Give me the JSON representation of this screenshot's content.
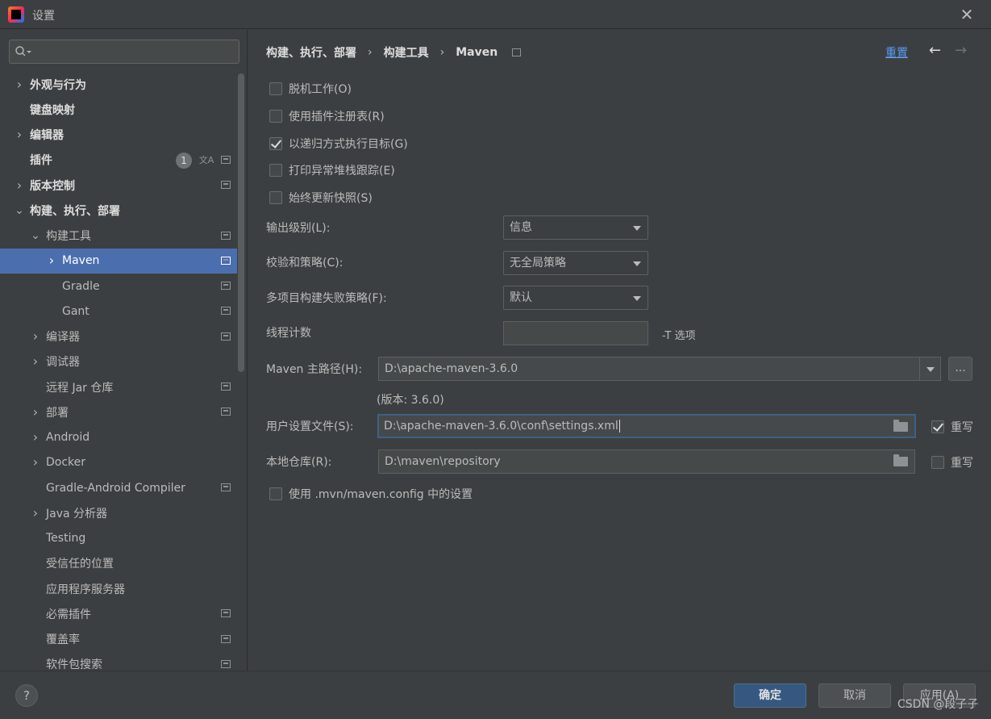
{
  "window": {
    "title": "设置",
    "close_glyph": "✕"
  },
  "sidebar": {
    "search_placeholder": "",
    "plugins_badge": "1",
    "items": [
      {
        "label": "外观与行为",
        "expandable": true,
        "level": 0
      },
      {
        "label": "键盘映射",
        "expandable": false,
        "level": 0
      },
      {
        "label": "编辑器",
        "expandable": true,
        "level": 0
      },
      {
        "label": "插件",
        "expandable": false,
        "level": 0
      },
      {
        "label": "版本控制",
        "expandable": true,
        "level": 0
      },
      {
        "label": "构建、执行、部署",
        "expandable": true,
        "expanded": true,
        "level": 0
      },
      {
        "label": "构建工具",
        "expandable": true,
        "expanded": true,
        "level": 1
      },
      {
        "label": "Maven",
        "expandable": true,
        "selected": true,
        "level": 2
      },
      {
        "label": "Gradle",
        "expandable": false,
        "level": 2
      },
      {
        "label": "Gant",
        "expandable": false,
        "level": 2
      },
      {
        "label": "编译器",
        "expandable": true,
        "level": 1
      },
      {
        "label": "调试器",
        "expandable": true,
        "level": 1
      },
      {
        "label": "远程 Jar 仓库",
        "expandable": false,
        "level": 1
      },
      {
        "label": "部署",
        "expandable": true,
        "level": 1
      },
      {
        "label": "Android",
        "expandable": true,
        "level": 1
      },
      {
        "label": "Docker",
        "expandable": true,
        "level": 1
      },
      {
        "label": "Gradle-Android Compiler",
        "expandable": false,
        "level": 1
      },
      {
        "label": "Java 分析器",
        "expandable": true,
        "level": 1
      },
      {
        "label": "Testing",
        "expandable": false,
        "level": 1
      },
      {
        "label": "受信任的位置",
        "expandable": false,
        "level": 1
      },
      {
        "label": "应用程序服务器",
        "expandable": false,
        "level": 1
      },
      {
        "label": "必需插件",
        "expandable": false,
        "level": 1
      },
      {
        "label": "覆盖率",
        "expandable": false,
        "level": 1
      },
      {
        "label": "软件包搜索",
        "expandable": false,
        "level": 1
      }
    ]
  },
  "breadcrumb": {
    "part1": "构建、执行、部署",
    "part2": "构建工具",
    "part3": "Maven",
    "separator": "›"
  },
  "header": {
    "reset_label": "重置",
    "back_glyph": "←",
    "forward_glyph": "→"
  },
  "options": {
    "offline": {
      "label": "脱机工作(O)",
      "checked": false
    },
    "plugin_registry": {
      "label": "使用插件注册表(R)",
      "checked": false
    },
    "recursive": {
      "label": "以递归方式执行目标(G)",
      "checked": true
    },
    "stacktrace": {
      "label": "打印异常堆栈跟踪(E)",
      "checked": false
    },
    "update_snapshots": {
      "label": "始终更新快照(S)",
      "checked": false
    },
    "use_mvn_config": {
      "label": "使用 .mvn/maven.config 中的设置",
      "checked": false
    }
  },
  "fields": {
    "output_level": {
      "label": "输出级别(L):",
      "value": "信息"
    },
    "checksum_policy": {
      "label": "校验和策略(C):",
      "value": "无全局策略"
    },
    "multiproject_fail": {
      "label": "多项目构建失败策略(F):",
      "value": "默认"
    },
    "thread_count": {
      "label": "线程计数",
      "value": "",
      "hint": "-T 选项"
    },
    "maven_home": {
      "label": "Maven 主路径(H):",
      "value": "D:\\apache-maven-3.6.0",
      "version": "(版本: 3.6.0)",
      "browse_label": "..."
    },
    "user_settings": {
      "label": "用户设置文件(S):",
      "value": "D:\\apache-maven-3.6.0\\conf\\settings.xml",
      "override_label": "重写",
      "override_checked": true
    },
    "local_repo": {
      "label": "本地仓库(R):",
      "value": "D:\\maven\\repository",
      "override_label": "重写",
      "override_checked": false
    }
  },
  "footer": {
    "help_glyph": "?",
    "ok_label": "确定",
    "cancel_label": "取消",
    "apply_label": "应用(A)"
  },
  "watermark": "CSDN @段子子",
  "colors": {
    "background": "#3c3f41",
    "selection": "#4b6eaf",
    "link": "#589df6",
    "primary_button": "#365880"
  }
}
